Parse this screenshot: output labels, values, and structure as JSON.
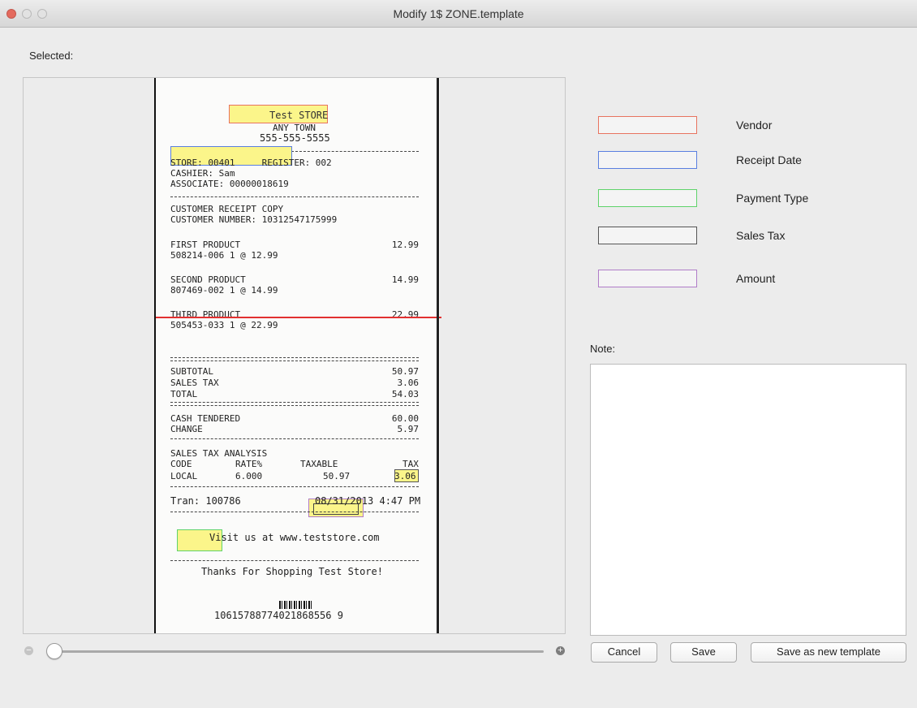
{
  "window": {
    "title": "Modify 1$ ZONE.template"
  },
  "selected_label": "Selected:",
  "receipt": {
    "store_name": "Test STORE",
    "town": "ANY TOWN",
    "phone": "555-555-5555",
    "store_line": "STORE: 00401     REGISTER: 002",
    "cashier": "CASHIER: Sam",
    "associate": "ASSOCIATE: 00000018619",
    "copy": "CUSTOMER RECEIPT COPY",
    "customer_number": "CUSTOMER NUMBER: 10312547175999",
    "items": [
      {
        "name": "FIRST PRODUCT",
        "detail": "508214-006 1 @ 12.99",
        "price": "12.99"
      },
      {
        "name": "SECOND PRODUCT",
        "detail": "807469-002 1 @ 14.99",
        "price": "14.99"
      },
      {
        "name": "THIRD PRODUCT",
        "detail": "505453-033 1 @ 22.99",
        "price": "22.99"
      }
    ],
    "subtotal_label": "SUBTOTAL",
    "subtotal": "50.97",
    "sales_tax_label": "SALES TAX",
    "sales_tax": "3.06",
    "total_label": "TOTAL",
    "total": "54.03",
    "cash_label": "CASH TENDERED",
    "cash": "60.00",
    "change_label": "CHANGE",
    "change": "5.97",
    "tax_analysis_title": "SALES TAX ANALYSIS",
    "tax_headers": [
      "CODE",
      "RATE%",
      "TAXABLE",
      "TAX"
    ],
    "tax_row": [
      "LOCAL",
      "6.000",
      "50.97",
      "3.06"
    ],
    "tran": "Tran: 100786",
    "datetime": "08/31/2013 4:47 PM",
    "visit": "Visit us at www.teststore.com",
    "thanks": "Thanks For Shopping Test Store!",
    "barcode_number": "10615788774021868556 9"
  },
  "legend": [
    {
      "label": "Vendor",
      "color": "#e8735f"
    },
    {
      "label": "Receipt Date",
      "color": "#5a7fe0"
    },
    {
      "label": "Payment Type",
      "color": "#5fd36a"
    },
    {
      "label": "Sales Tax",
      "color": "#555555"
    },
    {
      "label": "Amount",
      "color": "#b07cc8"
    }
  ],
  "note": {
    "label": "Note:",
    "value": ""
  },
  "buttons": {
    "cancel": "Cancel",
    "save": "Save",
    "save_new": "Save as new template"
  },
  "zoom": {
    "level": 0.0
  }
}
